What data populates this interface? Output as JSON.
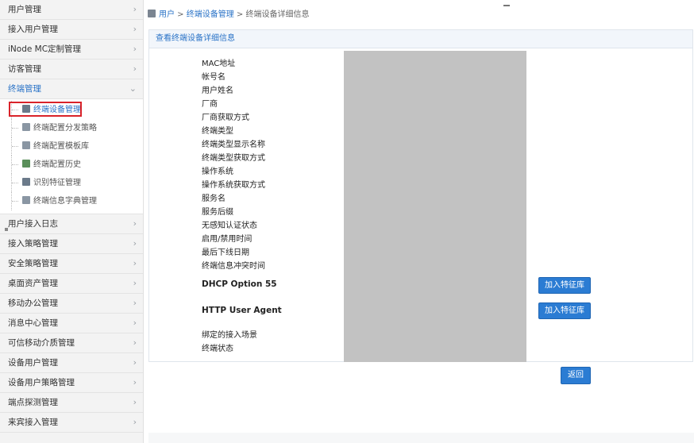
{
  "sidebar": {
    "items_top": [
      {
        "label": "用户管理"
      },
      {
        "label": "接入用户管理"
      },
      {
        "label": "iNode MC定制管理"
      },
      {
        "label": "访客管理"
      }
    ],
    "active_group": {
      "label": "终端管理"
    },
    "subitems": [
      {
        "label": "终端设备管理",
        "icon": "terminal-device-icon",
        "color": "#6b7a8a"
      },
      {
        "label": "终端配置分发策略",
        "icon": "config-dispatch-icon",
        "color": "#8a96a3"
      },
      {
        "label": "终端配置模板库",
        "icon": "template-library-icon",
        "color": "#8a96a3"
      },
      {
        "label": "终端配置历史",
        "icon": "config-history-icon",
        "color": "#5a8f5a"
      },
      {
        "label": "识别特征管理",
        "icon": "feature-icon",
        "color": "#6b7a8a"
      },
      {
        "label": "终端信息字典管理",
        "icon": "dictionary-icon",
        "color": "#8a96a3"
      }
    ],
    "items_bottom": [
      {
        "label": "用户接入日志"
      },
      {
        "label": "接入策略管理"
      },
      {
        "label": "安全策略管理"
      },
      {
        "label": "桌面资产管理"
      },
      {
        "label": "移动办公管理"
      },
      {
        "label": "消息中心管理"
      },
      {
        "label": "可信移动介质管理"
      },
      {
        "label": "设备用户管理"
      },
      {
        "label": "设备用户策略管理"
      },
      {
        "label": "端点探测管理"
      },
      {
        "label": "来宾接入管理"
      }
    ]
  },
  "breadcrumb": {
    "root": "用户",
    "sep1": " > ",
    "section": "终端设备管理",
    "sep2": " > ",
    "current": "终端设备详细信息"
  },
  "panel": {
    "title": "查看终端设备详细信息",
    "fields": [
      "MAC地址",
      "帐号名",
      "用户姓名",
      "厂商",
      "厂商获取方式",
      "终端类型",
      "终端类型显示名称",
      "终端类型获取方式",
      "操作系统",
      "操作系统获取方式",
      "服务名",
      "服务后缀",
      "无感知认证状态",
      "启用/禁用时间",
      "最后下线日期",
      "终端信息冲突时间"
    ],
    "dhcp_label": "DHCP Option 55",
    "http_label": "HTTP User Agent",
    "scene_label": "绑定的接入场景",
    "status_label": "终端状态",
    "add_feature_label": "加入特征库"
  },
  "back_label": "返回",
  "colors": {
    "accent": "#2b7cd3",
    "highlight_border": "#d9232a",
    "redaction": "#c2c2c2"
  }
}
